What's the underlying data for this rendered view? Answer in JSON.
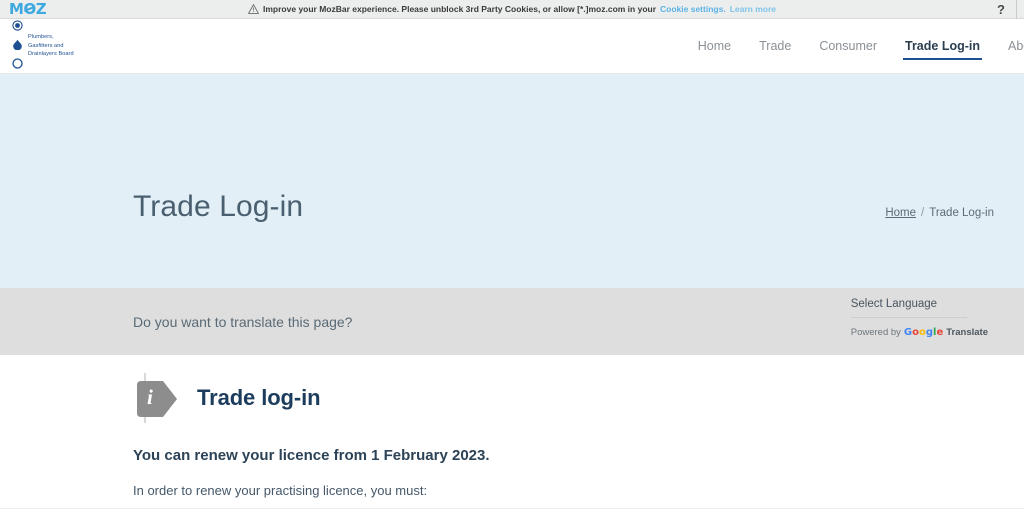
{
  "mozbar": {
    "logo": "MOZ",
    "notice_prefix": "Improve your MozBar experience. Please unblock 3rd Party Cookies, or allow [*.]moz.com in your",
    "cookie_settings_link": "Cookie settings.",
    "learn_more_link": "Learn more",
    "help_glyph": "?",
    "warning_icon": "warning-triangle-icon"
  },
  "header": {
    "brand": {
      "line1": "Plumbers,",
      "line2": "Gasfitters and",
      "line3": "Drainlayers Board"
    },
    "nav": [
      {
        "label": "Home",
        "active": false
      },
      {
        "label": "Trade",
        "active": false
      },
      {
        "label": "Consumer",
        "active": false
      },
      {
        "label": "Trade Log-in",
        "active": true
      },
      {
        "label": "Abo",
        "active": false
      }
    ]
  },
  "hero": {
    "title": "Trade Log-in",
    "breadcrumb": {
      "home": "Home",
      "separator": "/",
      "current": "Trade Log-in"
    },
    "scroll_toggle_icon": "chevron-down-icon"
  },
  "translate": {
    "question": "Do you want to translate this page?",
    "select_language": "Select Language",
    "powered_by": "Powered by",
    "google": {
      "g1": "G",
      "o1": "o",
      "o2": "o",
      "g2": "g",
      "l": "l",
      "e": "e"
    },
    "translate_word": "Translate"
  },
  "main": {
    "info_icon": "info-flag-icon",
    "info_icon_letter": "i",
    "heading": "Trade log-in",
    "lede": "You can renew your licence from 1 February 2023.",
    "paragraph": "In order to renew your practising licence, you must:"
  },
  "colors": {
    "moz_blue": "#3ea9e0",
    "brand_blue": "#1d4f91",
    "hero_bg": "#e3eff7",
    "translate_bg": "#dddedd",
    "heading_navy": "#1c3c5c"
  }
}
